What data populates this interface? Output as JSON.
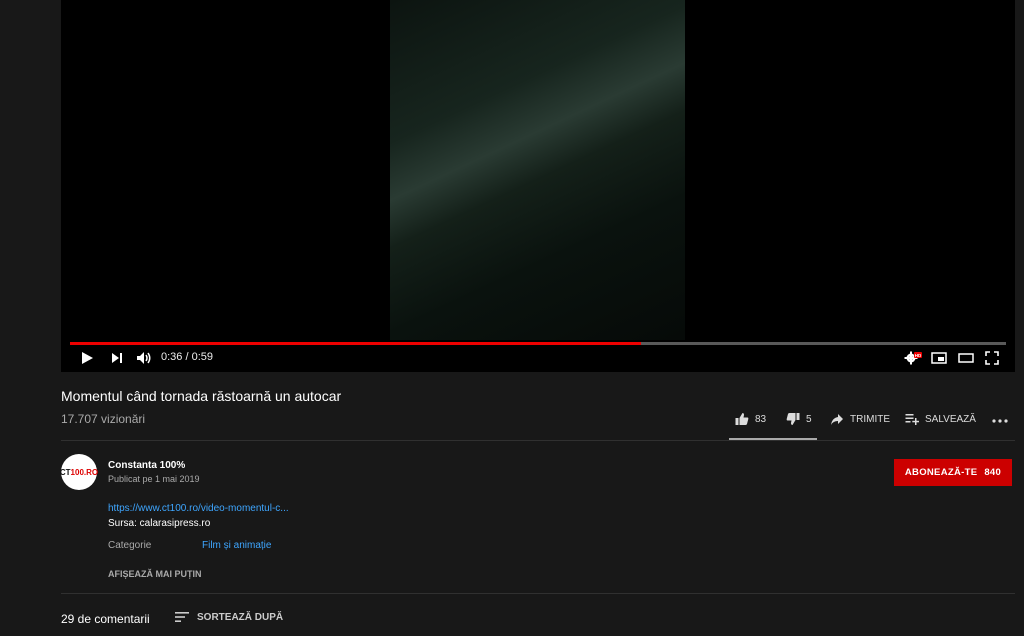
{
  "player": {
    "time_display": "0:36 / 0:59",
    "progress": 0.61,
    "hd_badge": "HD"
  },
  "video": {
    "title": "Momentul când tornada răstoarnă un autocar",
    "views": "17.707 vizionări"
  },
  "actions": {
    "likes": "83",
    "dislikes": "5",
    "share_label": "TRIMITE",
    "save_label": "SALVEAZĂ"
  },
  "channel": {
    "avatar_text_prefix": "CT",
    "avatar_text_accent": "100.RO",
    "name": "Constanta 100%",
    "published": "Publicat pe 1 mai 2019",
    "subscribe_label": "ABONEAZĂ-TE",
    "subscriber_count": "840"
  },
  "description": {
    "link": "https://www.ct100.ro/video-momentul-c...",
    "source": "Sursa: calarasipress.ro",
    "category_label": "Categorie",
    "category_value": "Film și animație",
    "show_less": "AFIȘEAZĂ MAI PUȚIN"
  },
  "comments": {
    "count": "29 de comentarii",
    "sort_label": "SORTEAZĂ DUPĂ"
  },
  "colors": {
    "background": "#181818",
    "accent_red": "#cc0000",
    "link_blue": "#3ea6ff"
  }
}
